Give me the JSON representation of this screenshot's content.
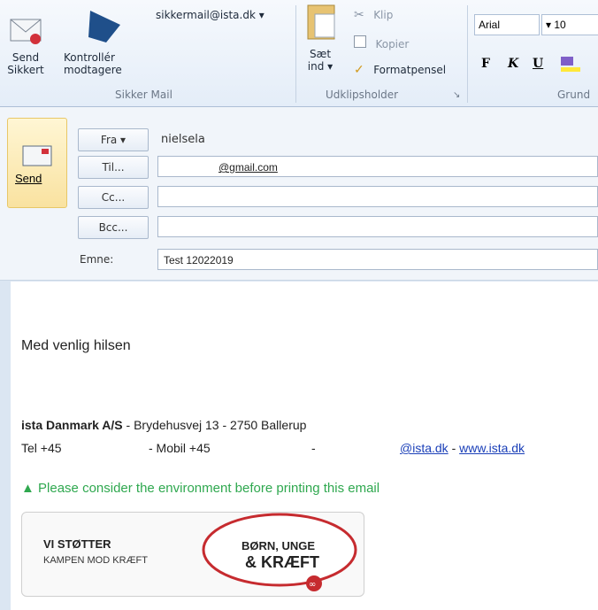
{
  "ribbon": {
    "send_secure": "Send\nSikkert",
    "check_recipients": "Kontrollér\nmodtagere",
    "account": "sikkermail@ista.dk ▾",
    "group_secure_mail": "Sikker Mail",
    "paste": "Sæt\nind ▾",
    "cut": "Klip",
    "copy": "Kopier",
    "format_painter": "Formatpensel",
    "group_clipboard": "Udklipsholder",
    "font_name": "Arial",
    "font_size": "▾ 10",
    "bold": "F",
    "italic": "K",
    "underline": "U",
    "group_basic": "Grund"
  },
  "header": {
    "send_label": "Send",
    "from_button": "Fra ▾",
    "from_value": "nielsela",
    "to_button": "Til...",
    "to_value": "@gmail.com",
    "cc_button": "Cc...",
    "bcc_button": "Bcc...",
    "subject_label": "Emne:",
    "subject_value": "Test 12022019"
  },
  "body": {
    "greeting": "Med venlig hilsen",
    "company": "ista Danmark A/S",
    "address": " - Brydehusvej 13 - 2750 Ballerup",
    "tel": "Tel +45",
    "mobile": "- Mobil +45",
    "dash": "-",
    "email": "@ista.dk",
    "sep": " - ",
    "website": "www.ista.dk",
    "env_note": "Please consider the environment before printing this email",
    "banner_left_1": "VI STØTTER",
    "banner_left_2": "KAMPEN MOD KRÆFT",
    "banner_right_1": "BØRN, UNGE",
    "banner_right_2": "& KRÆFT"
  }
}
